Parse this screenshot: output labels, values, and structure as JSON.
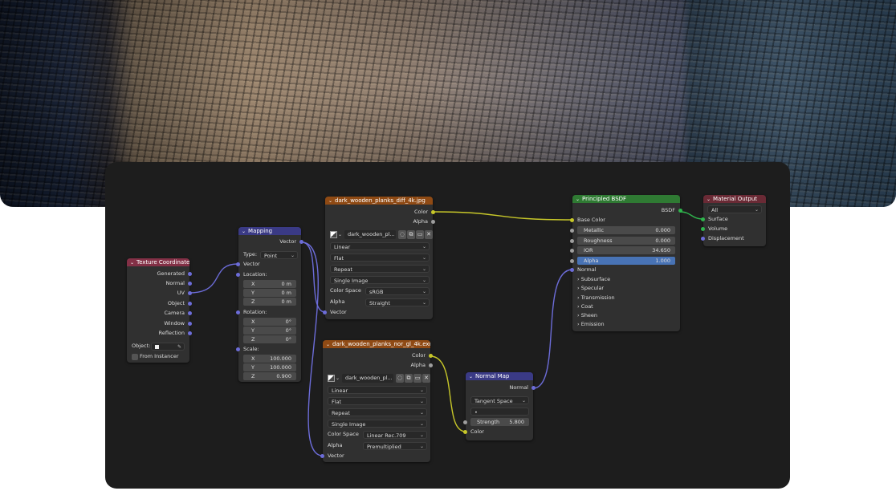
{
  "banner": {
    "alt": ""
  },
  "nodes": {
    "texture_coordinate": {
      "title": "Texture Coordinate",
      "outputs": [
        "Generated",
        "Normal",
        "UV",
        "Object",
        "Camera",
        "Window",
        "Reflection"
      ],
      "object_label": "Object:",
      "from_instancer": "From Instancer"
    },
    "mapping": {
      "title": "Mapping",
      "output": "Vector",
      "type_label": "Type:",
      "type_value": "Point",
      "vector_input": "Vector",
      "location_label": "Location:",
      "location": [
        {
          "axis": "X",
          "value": "0 m"
        },
        {
          "axis": "Y",
          "value": "0 m"
        },
        {
          "axis": "Z",
          "value": "0 m"
        }
      ],
      "rotation_label": "Rotation:",
      "rotation": [
        {
          "axis": "X",
          "value": "0°"
        },
        {
          "axis": "Y",
          "value": "0°"
        },
        {
          "axis": "Z",
          "value": "0°"
        }
      ],
      "scale_label": "Scale:",
      "scale": [
        {
          "axis": "X",
          "value": "100.000"
        },
        {
          "axis": "Y",
          "value": "100.000"
        },
        {
          "axis": "Z",
          "value": "0.900"
        }
      ]
    },
    "diff_texture": {
      "title": "dark_wooden_planks_diff_4k.jpg",
      "out_color": "Color",
      "out_alpha": "Alpha",
      "image_name": "dark_wooden_pl...",
      "interpolation": "Linear",
      "projection": "Flat",
      "extension": "Repeat",
      "source": "Single Image",
      "color_space_label": "Color Space",
      "color_space": "sRGB",
      "alpha_label": "Alpha",
      "alpha_mode": "Straight",
      "vector_input": "Vector"
    },
    "nor_texture": {
      "title": "dark_wooden_planks_nor_gl_4k.exr",
      "out_color": "Color",
      "out_alpha": "Alpha",
      "image_name": "dark_wooden_pl...",
      "interpolation": "Linear",
      "projection": "Flat",
      "extension": "Repeat",
      "source": "Single Image",
      "color_space_label": "Color Space",
      "color_space": "Linear Rec.709",
      "alpha_label": "Alpha",
      "alpha_mode": "Premultiplied",
      "vector_input": "Vector"
    },
    "normal_map": {
      "title": "Normal Map",
      "output": "Normal",
      "space": "Tangent Space",
      "uv_field": "•",
      "strength_label": "Strength",
      "strength_value": "5.800",
      "color_input": "Color"
    },
    "principled_bsdf": {
      "title": "Principled BSDF",
      "output": "BSDF",
      "base_color": "Base Color",
      "metallic_label": "Metallic",
      "metallic": "0.000",
      "roughness_label": "Roughness",
      "roughness": "0.000",
      "ior_label": "IOR",
      "ior": "34.650",
      "alpha_label": "Alpha",
      "alpha": "1.000",
      "normal": "Normal",
      "panels": [
        "Subsurface",
        "Specular",
        "Transmission",
        "Coat",
        "Sheen",
        "Emission"
      ]
    },
    "material_output": {
      "title": "Material Output",
      "target": "All",
      "inputs": [
        "Surface",
        "Volume",
        "Displacement"
      ]
    }
  },
  "colors": {
    "input_header": "#833046",
    "vector_header": "#3a3a85",
    "texture_header": "#8f4a14",
    "shader_header": "#2f7a33",
    "output_header": "#6a2a35",
    "socket_vector": "#6c6cd8",
    "socket_color": "#c7c729",
    "socket_float": "#9e9e9e",
    "socket_shader": "#2fb54d",
    "alpha_highlight": "#4873b5"
  }
}
